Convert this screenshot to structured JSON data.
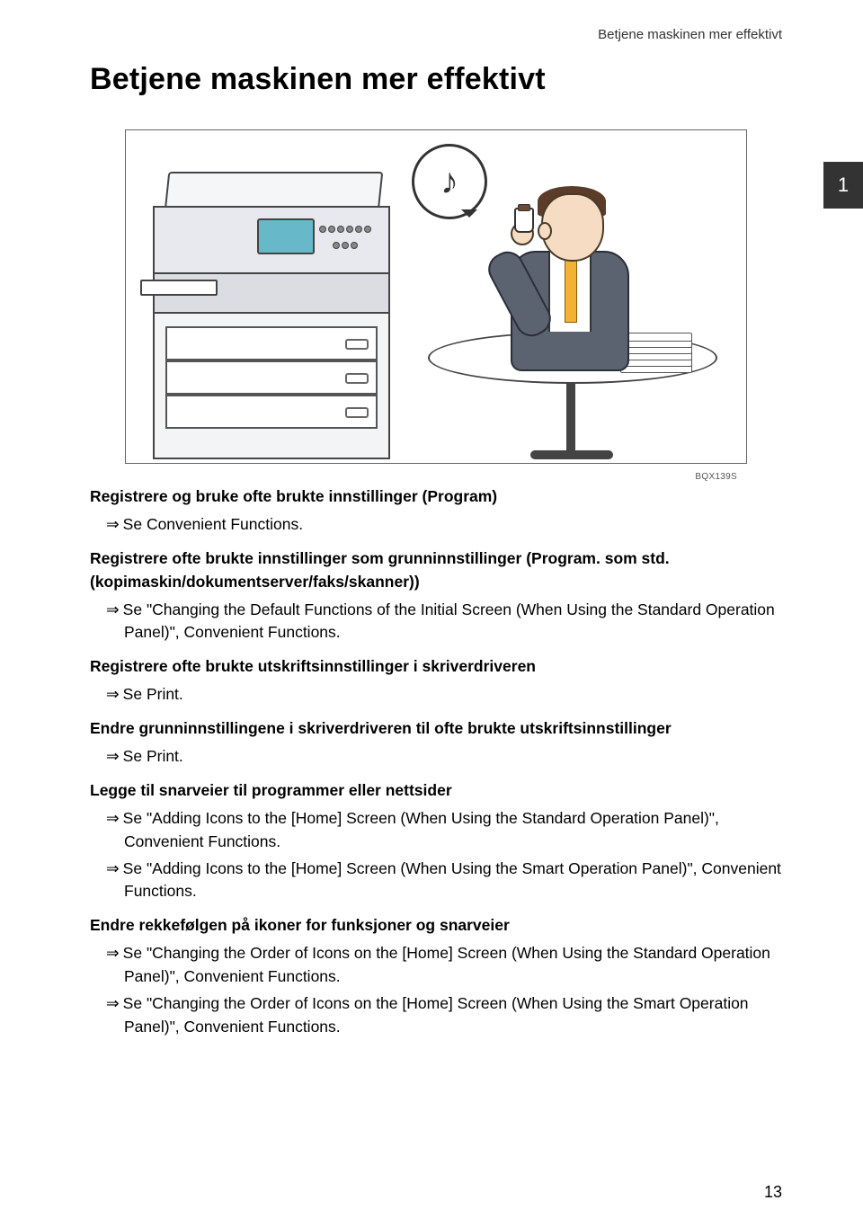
{
  "runningHeader": "Betjene maskinen mer effektivt",
  "pageTitle": "Betjene maskinen mer effektivt",
  "chapterNumber": "1",
  "illustrationCode": "BQX139S",
  "noteSymbol": "♪",
  "arrow": "⇒",
  "sections": [
    {
      "head": "Registrere og bruke ofte brukte innstillinger (Program)",
      "refs": [
        "Se Convenient Functions."
      ]
    },
    {
      "head": "Registrere ofte brukte innstillinger som grunninnstillinger (Program. som std. (kopimaskin/dokumentserver/faks/skanner))",
      "refs": [
        "Se \"Changing the Default Functions of the Initial Screen (When Using the Standard Operation Panel)\", Convenient Functions."
      ]
    },
    {
      "head": "Registrere ofte brukte utskriftsinnstillinger i skriverdriveren",
      "refs": [
        "Se Print."
      ]
    },
    {
      "head": "Endre grunninnstillingene i skriverdriveren til ofte brukte utskriftsinnstillinger",
      "refs": [
        "Se Print."
      ]
    },
    {
      "head": "Legge til snarveier til programmer eller nettsider",
      "refs": [
        "Se \"Adding Icons to the [Home] Screen (When Using the Standard Operation Panel)\", Convenient Functions.",
        "Se \"Adding Icons to the [Home] Screen (When Using the Smart Operation Panel)\", Convenient Functions."
      ]
    },
    {
      "head": "Endre rekkefølgen på ikoner for funksjoner og snarveier",
      "refs": [
        "Se \"Changing the Order of Icons on the [Home] Screen (When Using the Standard Operation Panel)\", Convenient Functions.",
        "Se \"Changing the Order of Icons on the [Home] Screen (When Using the Smart Operation Panel)\", Convenient Functions."
      ]
    }
  ],
  "pageNumber": "13"
}
